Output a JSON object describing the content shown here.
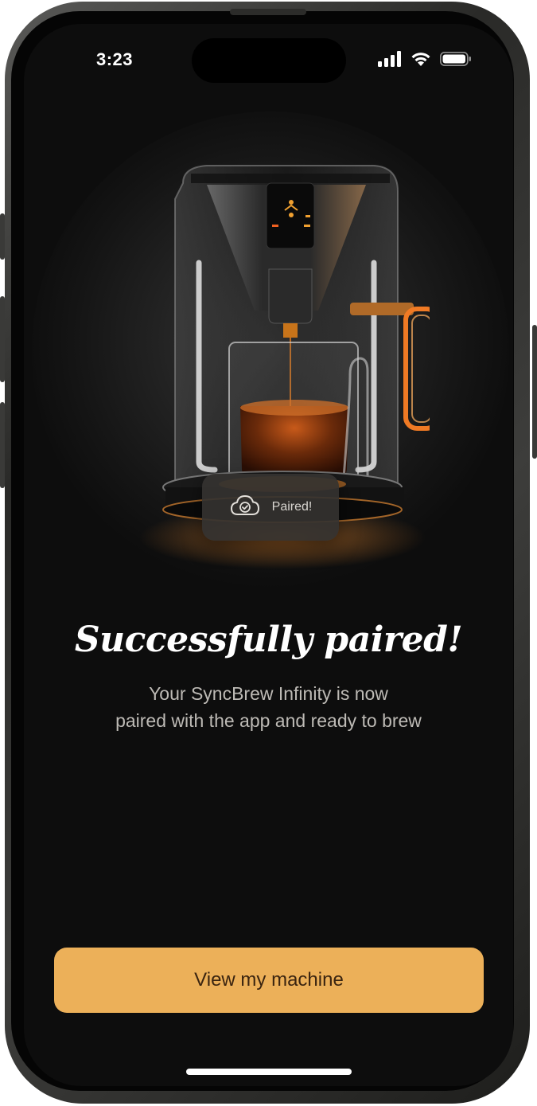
{
  "status_bar": {
    "time": "3:23",
    "signal_icon": "cellular-signal-icon",
    "wifi_icon": "wifi-icon",
    "battery_icon": "battery-icon"
  },
  "hero": {
    "image": "coffee-machine-illustration",
    "toast": {
      "icon": "cloud-check-icon",
      "label": "Paired!"
    }
  },
  "content": {
    "title": "Successfully paired!",
    "subtitle_line1": "Your SyncBrew Infinity is now",
    "subtitle_line2": "paired with the app and ready to brew"
  },
  "actions": {
    "primary_label": "View my machine"
  },
  "colors": {
    "background": "#0d0d0d",
    "accent": "#ecb059",
    "accent_text": "#3a2410",
    "machine_glow": "#f08a2a"
  }
}
